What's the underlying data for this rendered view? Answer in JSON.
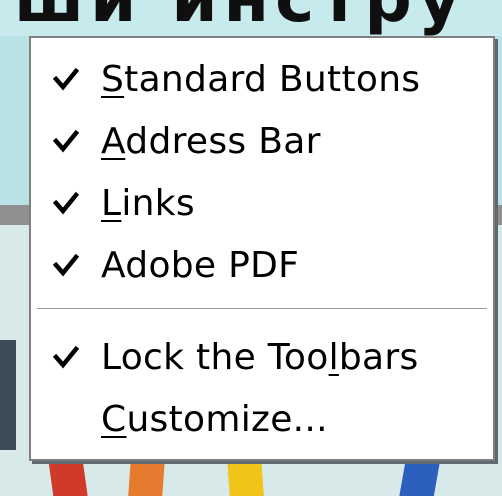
{
  "background": {
    "title_fragment": "ши инстру"
  },
  "menu": {
    "items": [
      {
        "label": "Standard Buttons",
        "mnemonic_index": 0,
        "checked": true
      },
      {
        "label": "Address Bar",
        "mnemonic_index": 0,
        "checked": true
      },
      {
        "label": "Links",
        "mnemonic_index": 0,
        "checked": true
      },
      {
        "label": "Adobe PDF",
        "mnemonic_index": -1,
        "checked": true
      },
      {
        "label": "Lock the Toolbars",
        "mnemonic_index": 12,
        "checked": true
      },
      {
        "label": "Customize...",
        "mnemonic_index": 0,
        "checked": false
      }
    ]
  },
  "colors": {
    "menu_background": "#ffffff",
    "menu_border": "#7f7f7f",
    "text": "#000000"
  }
}
